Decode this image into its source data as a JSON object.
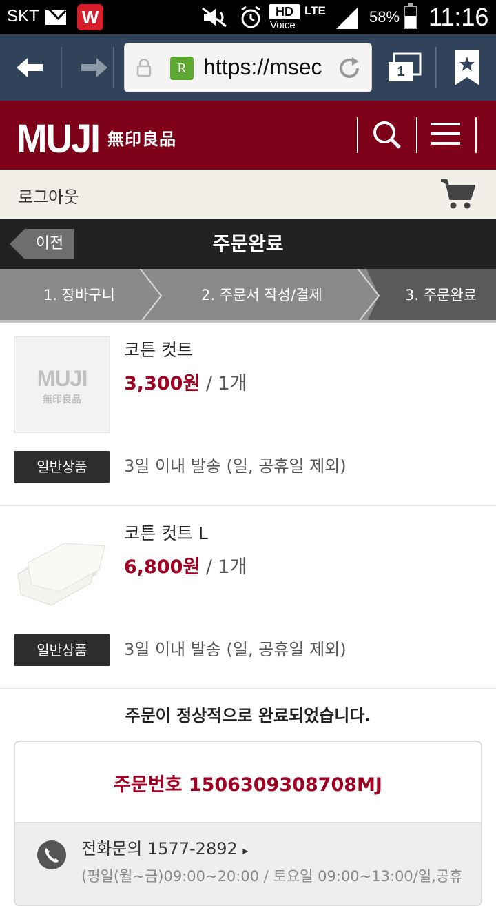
{
  "status_bar": {
    "carrier": "SKT",
    "app_badge": "W",
    "hd": "HD",
    "voice": "Voice",
    "network": "LTE",
    "battery": "58%",
    "battery_level": 0.58,
    "time": "11:16"
  },
  "browser": {
    "url": "https://msec",
    "favicon": "R",
    "tab_count": "1"
  },
  "header": {
    "logo": "MUJI",
    "logo_sub": "無印良品"
  },
  "sub_bar": {
    "logout": "로그아웃"
  },
  "title_bar": {
    "prev": "이전",
    "title": "주문완료"
  },
  "steps": [
    "1. 장바구니",
    "2. 주문서 작성/결제",
    "3. 주문완료"
  ],
  "products": [
    {
      "name": "코튼 컷트",
      "price": "3,300원",
      "qty": " / 1개",
      "badge": "일반상품",
      "shipping": "3일 이내 발송 (일, 공휴일 제외)",
      "thumb_logo": "MUJI",
      "thumb_sub": "無印良品"
    },
    {
      "name": "코튼 컷트 L",
      "price": "6,800원",
      "qty": " / 1개",
      "badge": "일반상품",
      "shipping": "3일 이내 발송 (일, 공휴일 제외)"
    }
  ],
  "completion": {
    "message": "주문이 정상적으로 완료되었습니다.",
    "order_number": "주문번호 1506309308708MJ",
    "contact_line": "전화문의 1577-2892",
    "contact_hours": "(평일(월~금)09:00~20:00 / 토요일 09:00~13:00/일,공휴"
  },
  "colors": {
    "brand": "#7f0019",
    "price": "#a00022",
    "browser_bar": "#30435a"
  }
}
